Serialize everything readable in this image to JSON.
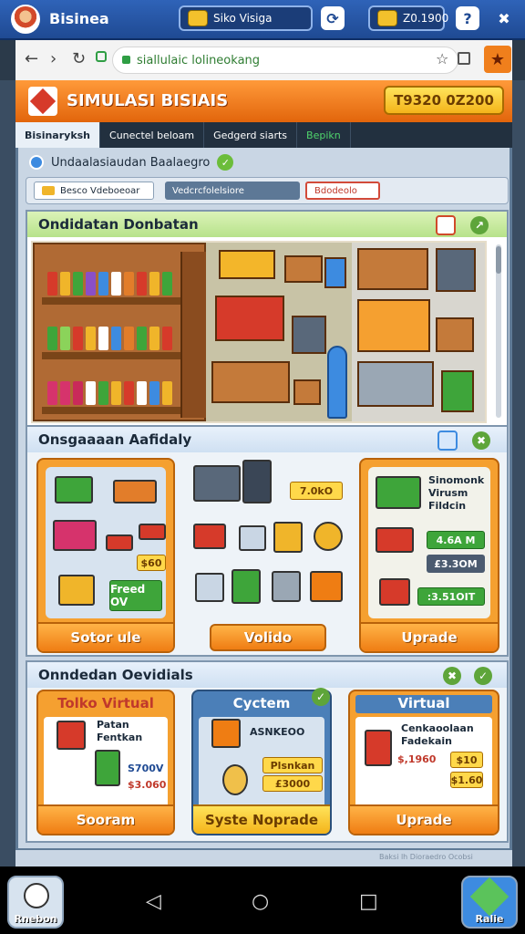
{
  "topbar": {
    "app_name": "Bisinea",
    "slot_left": "Siko Visiga",
    "slot_right": "Z0.1900"
  },
  "browser": {
    "url": "siallulaic lolineokang"
  },
  "game": {
    "title": "SIMULASI BISIAIS",
    "money": "T9320 0Z200"
  },
  "menu_tabs": [
    "Bisinaryksh",
    "Cunectel beloam",
    "Gedgerd siarts",
    "Bepikn"
  ],
  "info": {
    "label": "Undaalasiaudan Baalaegro"
  },
  "toolbar": {
    "field1": "Besco Vdeboeoar",
    "field2": "Vedcrcfolelsiore",
    "field3": "Bdodeolo"
  },
  "sections": {
    "shop": {
      "title": "Ondidatan Donbatan"
    },
    "upgrades": {
      "title": "Onsgaaaan Aafidaly"
    },
    "offers": {
      "title": "Onndedan Oevidials"
    }
  },
  "upgrade_cards": {
    "left_button": "Sotor ule",
    "left_price": "Freed OV",
    "left_tag": "$60",
    "middle_tag": "7.0kO",
    "middle_button": "Volido",
    "right_text": [
      "Sinomonk",
      "Virusm",
      "Fildcin"
    ],
    "right_price1": "4.6A M",
    "right_price2": "£3.3OM",
    "right_price3": ":3.51OIT",
    "right_button": "Uprade"
  },
  "offer_cards": [
    {
      "title": "Tolko Virtual",
      "lines": [
        "Patan",
        "Fentkan"
      ],
      "price1": "S700V",
      "price2": "$3.060",
      "button": "Sooram"
    },
    {
      "title": "Cyctem",
      "lines": [
        "ASNKEOO"
      ],
      "price1": "Plsnkan",
      "price2": "£3000",
      "button": "Syste Noprade"
    },
    {
      "title": "Virtual",
      "lines": [
        "Cenkaoolaan",
        "Fadekain"
      ],
      "price1": "$,1960",
      "price2": "$10",
      "price3": "$1.60",
      "button": "Uprade"
    }
  ],
  "footer": {
    "credit": "Baksi lh Dioraedro Ocobsi"
  },
  "corner_apps": {
    "left": "Rnebon",
    "right": "Ralie"
  },
  "colors": {
    "accent_orange": "#ef7d13",
    "brand_blue": "#2f63b8",
    "money_yellow": "#f4b41a",
    "positive_green": "#3ea53a"
  }
}
